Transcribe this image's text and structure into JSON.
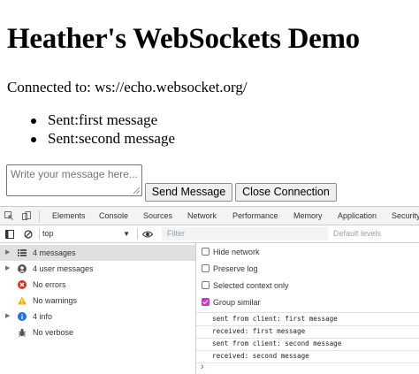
{
  "page": {
    "title": "Heather's WebSockets Demo",
    "status": "Connected to: ws://echo.websocket.org/",
    "sent_messages": [
      "Sent:first message",
      "Sent:second message"
    ],
    "textarea_placeholder": "Write your message here...",
    "send_button": "Send Message",
    "close_button": "Close Connection"
  },
  "devtools": {
    "tabs": [
      "Elements",
      "Console",
      "Sources",
      "Network",
      "Performance",
      "Memory",
      "Application",
      "Security"
    ],
    "active_tab": "Console",
    "context": "top",
    "filter_placeholder": "Filter",
    "levels": "Default levels",
    "sidebar": [
      {
        "label": "4 messages",
        "icon": "list-icon",
        "expandable": true,
        "selected": true
      },
      {
        "label": "4 user messages",
        "icon": "user-icon",
        "expandable": true,
        "selected": false
      },
      {
        "label": "No errors",
        "icon": "error-icon",
        "expandable": false,
        "selected": false
      },
      {
        "label": "No warnings",
        "icon": "warning-icon",
        "expandable": false,
        "selected": false
      },
      {
        "label": "4 info",
        "icon": "info-icon",
        "expandable": true,
        "selected": false
      },
      {
        "label": "No verbose",
        "icon": "bug-icon",
        "expandable": false,
        "selected": false
      }
    ],
    "settings": [
      {
        "label": "Hide network",
        "checked": false
      },
      {
        "label": "Preserve log",
        "checked": false
      },
      {
        "label": "Selected context only",
        "checked": false
      },
      {
        "label": "Group similar",
        "checked": true
      }
    ],
    "logs": [
      "sent from client: first message",
      "received: first message",
      "sent from client: second message",
      "received: second message"
    ],
    "prompt": "›",
    "colors": {
      "accent": "#1a73e8",
      "checkbox": "#c540c5",
      "error": "#d93025",
      "warning": "#f9ab00",
      "info": "#1a73e8"
    }
  }
}
